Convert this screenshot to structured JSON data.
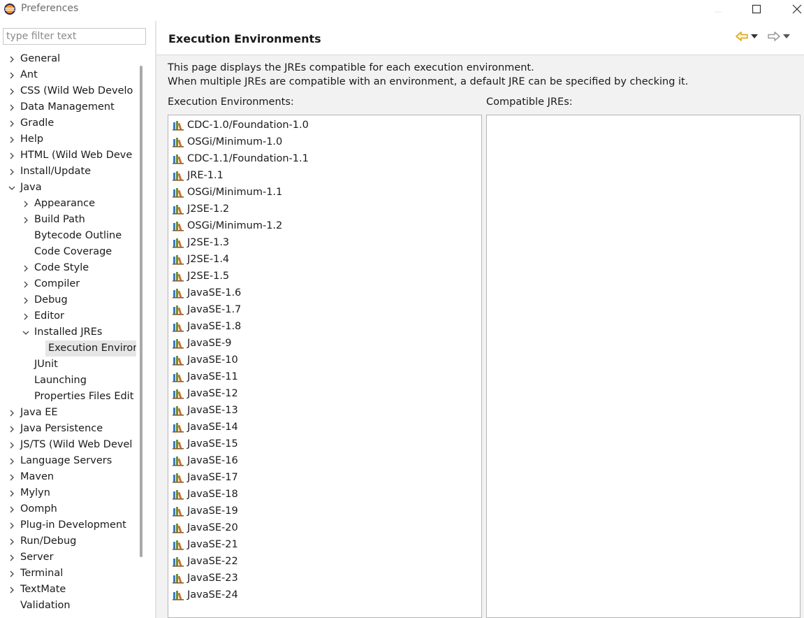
{
  "window": {
    "title": "Preferences"
  },
  "filter": {
    "placeholder": "type filter text"
  },
  "tree": [
    {
      "label": "General",
      "level": 0,
      "expander": "collapsed"
    },
    {
      "label": "Ant",
      "level": 0,
      "expander": "collapsed"
    },
    {
      "label": "CSS (Wild Web Develo",
      "level": 0,
      "expander": "collapsed"
    },
    {
      "label": "Data Management",
      "level": 0,
      "expander": "collapsed"
    },
    {
      "label": "Gradle",
      "level": 0,
      "expander": "collapsed"
    },
    {
      "label": "Help",
      "level": 0,
      "expander": "collapsed"
    },
    {
      "label": "HTML (Wild Web Deve",
      "level": 0,
      "expander": "collapsed"
    },
    {
      "label": "Install/Update",
      "level": 0,
      "expander": "collapsed"
    },
    {
      "label": "Java",
      "level": 0,
      "expander": "expanded"
    },
    {
      "label": "Appearance",
      "level": 1,
      "expander": "collapsed"
    },
    {
      "label": "Build Path",
      "level": 1,
      "expander": "collapsed"
    },
    {
      "label": "Bytecode Outline",
      "level": 1,
      "expander": "none"
    },
    {
      "label": "Code Coverage",
      "level": 1,
      "expander": "none"
    },
    {
      "label": "Code Style",
      "level": 1,
      "expander": "collapsed"
    },
    {
      "label": "Compiler",
      "level": 1,
      "expander": "collapsed"
    },
    {
      "label": "Debug",
      "level": 1,
      "expander": "collapsed"
    },
    {
      "label": "Editor",
      "level": 1,
      "expander": "collapsed"
    },
    {
      "label": "Installed JREs",
      "level": 1,
      "expander": "expanded"
    },
    {
      "label": "Execution Environ",
      "level": 2,
      "expander": "none",
      "selected": true
    },
    {
      "label": "JUnit",
      "level": 1,
      "expander": "none"
    },
    {
      "label": "Launching",
      "level": 1,
      "expander": "none"
    },
    {
      "label": "Properties Files Edit",
      "level": 1,
      "expander": "none"
    },
    {
      "label": "Java EE",
      "level": 0,
      "expander": "collapsed"
    },
    {
      "label": "Java Persistence",
      "level": 0,
      "expander": "collapsed"
    },
    {
      "label": "JS/TS (Wild Web Devel",
      "level": 0,
      "expander": "collapsed"
    },
    {
      "label": "Language Servers",
      "level": 0,
      "expander": "collapsed"
    },
    {
      "label": "Maven",
      "level": 0,
      "expander": "collapsed"
    },
    {
      "label": "Mylyn",
      "level": 0,
      "expander": "collapsed"
    },
    {
      "label": "Oomph",
      "level": 0,
      "expander": "collapsed"
    },
    {
      "label": "Plug-in Development",
      "level": 0,
      "expander": "collapsed"
    },
    {
      "label": "Run/Debug",
      "level": 0,
      "expander": "collapsed"
    },
    {
      "label": "Server",
      "level": 0,
      "expander": "collapsed"
    },
    {
      "label": "Terminal",
      "level": 0,
      "expander": "collapsed"
    },
    {
      "label": "TextMate",
      "level": 0,
      "expander": "collapsed"
    },
    {
      "label": "Validation",
      "level": 0,
      "expander": "none"
    }
  ],
  "page": {
    "title": "Execution Environments",
    "description_line1": "This page displays the JREs compatible for each execution environment.",
    "description_line2": "When multiple JREs are compatible with an environment, a default JRE can be specified by checking it.",
    "env_label": "Execution Environments:",
    "jre_label": "Compatible JREs:"
  },
  "environments": [
    "CDC-1.0/Foundation-1.0",
    "OSGi/Minimum-1.0",
    "CDC-1.1/Foundation-1.1",
    "JRE-1.1",
    "OSGi/Minimum-1.1",
    "J2SE-1.2",
    "OSGi/Minimum-1.2",
    "J2SE-1.3",
    "J2SE-1.4",
    "J2SE-1.5",
    "JavaSE-1.6",
    "JavaSE-1.7",
    "JavaSE-1.8",
    "JavaSE-9",
    "JavaSE-10",
    "JavaSE-11",
    "JavaSE-12",
    "JavaSE-13",
    "JavaSE-14",
    "JavaSE-15",
    "JavaSE-16",
    "JavaSE-17",
    "JavaSE-18",
    "JavaSE-19",
    "JavaSE-20",
    "JavaSE-21",
    "JavaSE-22",
    "JavaSE-23",
    "JavaSE-24"
  ],
  "compatible_jres": [],
  "icons": {
    "app": "eclipse-icon",
    "back": "back-arrow-icon",
    "forward": "forward-arrow-icon",
    "env": "library-icon"
  },
  "colors": {
    "back_arrow": "#d9a520",
    "forward_arrow": "#9a9a9a",
    "selection": "#e6e6e6"
  }
}
